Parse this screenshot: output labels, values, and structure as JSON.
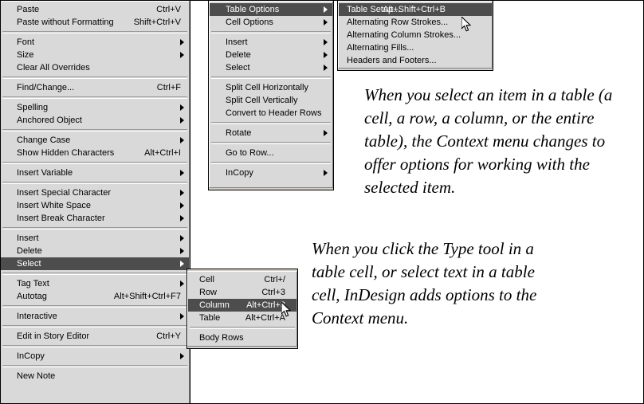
{
  "main_menu": {
    "name": "Context menu",
    "groups": [
      {
        "items": [
          {
            "label": "Paste",
            "accel": "Ctrl+V",
            "submenu": false,
            "selected": false
          },
          {
            "label": "Paste without Formatting",
            "accel": "Shift+Ctrl+V",
            "submenu": false,
            "selected": false
          }
        ]
      },
      {
        "items": [
          {
            "label": "Font",
            "accel": "",
            "submenu": true,
            "selected": false
          },
          {
            "label": "Size",
            "accel": "",
            "submenu": true,
            "selected": false
          },
          {
            "label": "Clear All Overrides",
            "accel": "",
            "submenu": false,
            "selected": false
          }
        ]
      },
      {
        "items": [
          {
            "label": "Find/Change...",
            "accel": "Ctrl+F",
            "submenu": false,
            "selected": false
          }
        ]
      },
      {
        "items": [
          {
            "label": "Spelling",
            "accel": "",
            "submenu": true,
            "selected": false
          },
          {
            "label": "Anchored Object",
            "accel": "",
            "submenu": true,
            "selected": false
          }
        ]
      },
      {
        "items": [
          {
            "label": "Change Case",
            "accel": "",
            "submenu": true,
            "selected": false
          },
          {
            "label": "Show Hidden Characters",
            "accel": "Alt+Ctrl+I",
            "submenu": false,
            "selected": false
          }
        ]
      },
      {
        "items": [
          {
            "label": "Insert Variable",
            "accel": "",
            "submenu": true,
            "selected": false
          }
        ]
      },
      {
        "items": [
          {
            "label": "Insert Special Character",
            "accel": "",
            "submenu": true,
            "selected": false
          },
          {
            "label": "Insert White Space",
            "accel": "",
            "submenu": true,
            "selected": false
          },
          {
            "label": "Insert Break Character",
            "accel": "",
            "submenu": true,
            "selected": false
          }
        ]
      },
      {
        "items": [
          {
            "label": "Insert",
            "accel": "",
            "submenu": true,
            "selected": false
          },
          {
            "label": "Delete",
            "accel": "",
            "submenu": true,
            "selected": false
          },
          {
            "label": "Select",
            "accel": "",
            "submenu": true,
            "selected": true
          }
        ]
      },
      {
        "items": [
          {
            "label": "Tag Text",
            "accel": "",
            "submenu": true,
            "selected": false
          },
          {
            "label": "Autotag",
            "accel": "Alt+Shift+Ctrl+F7",
            "submenu": false,
            "selected": false
          }
        ]
      },
      {
        "items": [
          {
            "label": "Interactive",
            "accel": "",
            "submenu": true,
            "selected": false
          }
        ]
      },
      {
        "items": [
          {
            "label": "Edit in Story Editor",
            "accel": "Ctrl+Y",
            "submenu": false,
            "selected": false
          }
        ]
      },
      {
        "items": [
          {
            "label": "InCopy",
            "accel": "",
            "submenu": true,
            "selected": false
          }
        ]
      },
      {
        "items": [
          {
            "label": "New Note",
            "accel": "",
            "submenu": false,
            "selected": false
          }
        ]
      }
    ]
  },
  "table_menu": {
    "name": "Table context menu",
    "groups": [
      {
        "items": [
          {
            "label": "Table Options",
            "accel": "",
            "submenu": true,
            "selected": true
          },
          {
            "label": "Cell Options",
            "accel": "",
            "submenu": true,
            "selected": false
          }
        ]
      },
      {
        "items": [
          {
            "label": "Insert",
            "accel": "",
            "submenu": true,
            "selected": false
          },
          {
            "label": "Delete",
            "accel": "",
            "submenu": true,
            "selected": false
          },
          {
            "label": "Select",
            "accel": "",
            "submenu": true,
            "selected": false
          }
        ]
      },
      {
        "items": [
          {
            "label": "Split Cell Horizontally",
            "accel": "",
            "submenu": false,
            "selected": false
          },
          {
            "label": "Split Cell Vertically",
            "accel": "",
            "submenu": false,
            "selected": false
          },
          {
            "label": "Convert to Header Rows",
            "accel": "",
            "submenu": false,
            "selected": false
          }
        ]
      },
      {
        "items": [
          {
            "label": "Rotate",
            "accel": "",
            "submenu": true,
            "selected": false
          }
        ]
      },
      {
        "items": [
          {
            "label": "Go to Row...",
            "accel": "",
            "submenu": false,
            "selected": false
          }
        ]
      },
      {
        "items": [
          {
            "label": "InCopy",
            "accel": "",
            "submenu": true,
            "selected": false
          }
        ]
      }
    ]
  },
  "table_options_submenu": {
    "name": "Table Options submenu",
    "groups": [
      {
        "items": [
          {
            "label": "Table Setup...",
            "accel": "Alt+Shift+Ctrl+B",
            "submenu": false,
            "selected": true
          },
          {
            "label": "Alternating Row Strokes...",
            "accel": "",
            "submenu": false,
            "selected": false
          },
          {
            "label": "Alternating Column Strokes...",
            "accel": "",
            "submenu": false,
            "selected": false
          },
          {
            "label": "Alternating Fills...",
            "accel": "",
            "submenu": false,
            "selected": false
          },
          {
            "label": "Headers and Footers...",
            "accel": "",
            "submenu": false,
            "selected": false
          }
        ]
      }
    ]
  },
  "select_submenu": {
    "name": "Select submenu",
    "groups": [
      {
        "items": [
          {
            "label": "Cell",
            "accel": "Ctrl+/",
            "submenu": false,
            "selected": false
          },
          {
            "label": "Row",
            "accel": "Ctrl+3",
            "submenu": false,
            "selected": false
          },
          {
            "label": "Column",
            "accel": "Alt+Ctrl+3",
            "submenu": false,
            "selected": true
          },
          {
            "label": "Table",
            "accel": "Alt+Ctrl+A",
            "submenu": false,
            "selected": false
          }
        ]
      },
      {
        "items": [
          {
            "label": "Body Rows",
            "accel": "",
            "submenu": false,
            "selected": false
          }
        ]
      }
    ]
  },
  "captions": {
    "caption_1": "When you select an item in a table (a cell, a row, a column, or the entire table), the Context menu changes to offer options for working with the selected item.",
    "caption_2": "When you click the Type tool in a table cell, or select text in a table cell, InDesign adds options to the Context menu."
  },
  "cursors": {
    "top": "mouse-pointer-arrow",
    "bottom": "mouse-pointer-arrow"
  },
  "colors": {
    "menu_background": "#d9d9d9",
    "menu_border": "#000000",
    "highlight": "#4d4d4d",
    "highlight_text": "#ffffff",
    "text": "#000000",
    "separator": "#9a9a9a",
    "page_background": "#ffffff"
  }
}
